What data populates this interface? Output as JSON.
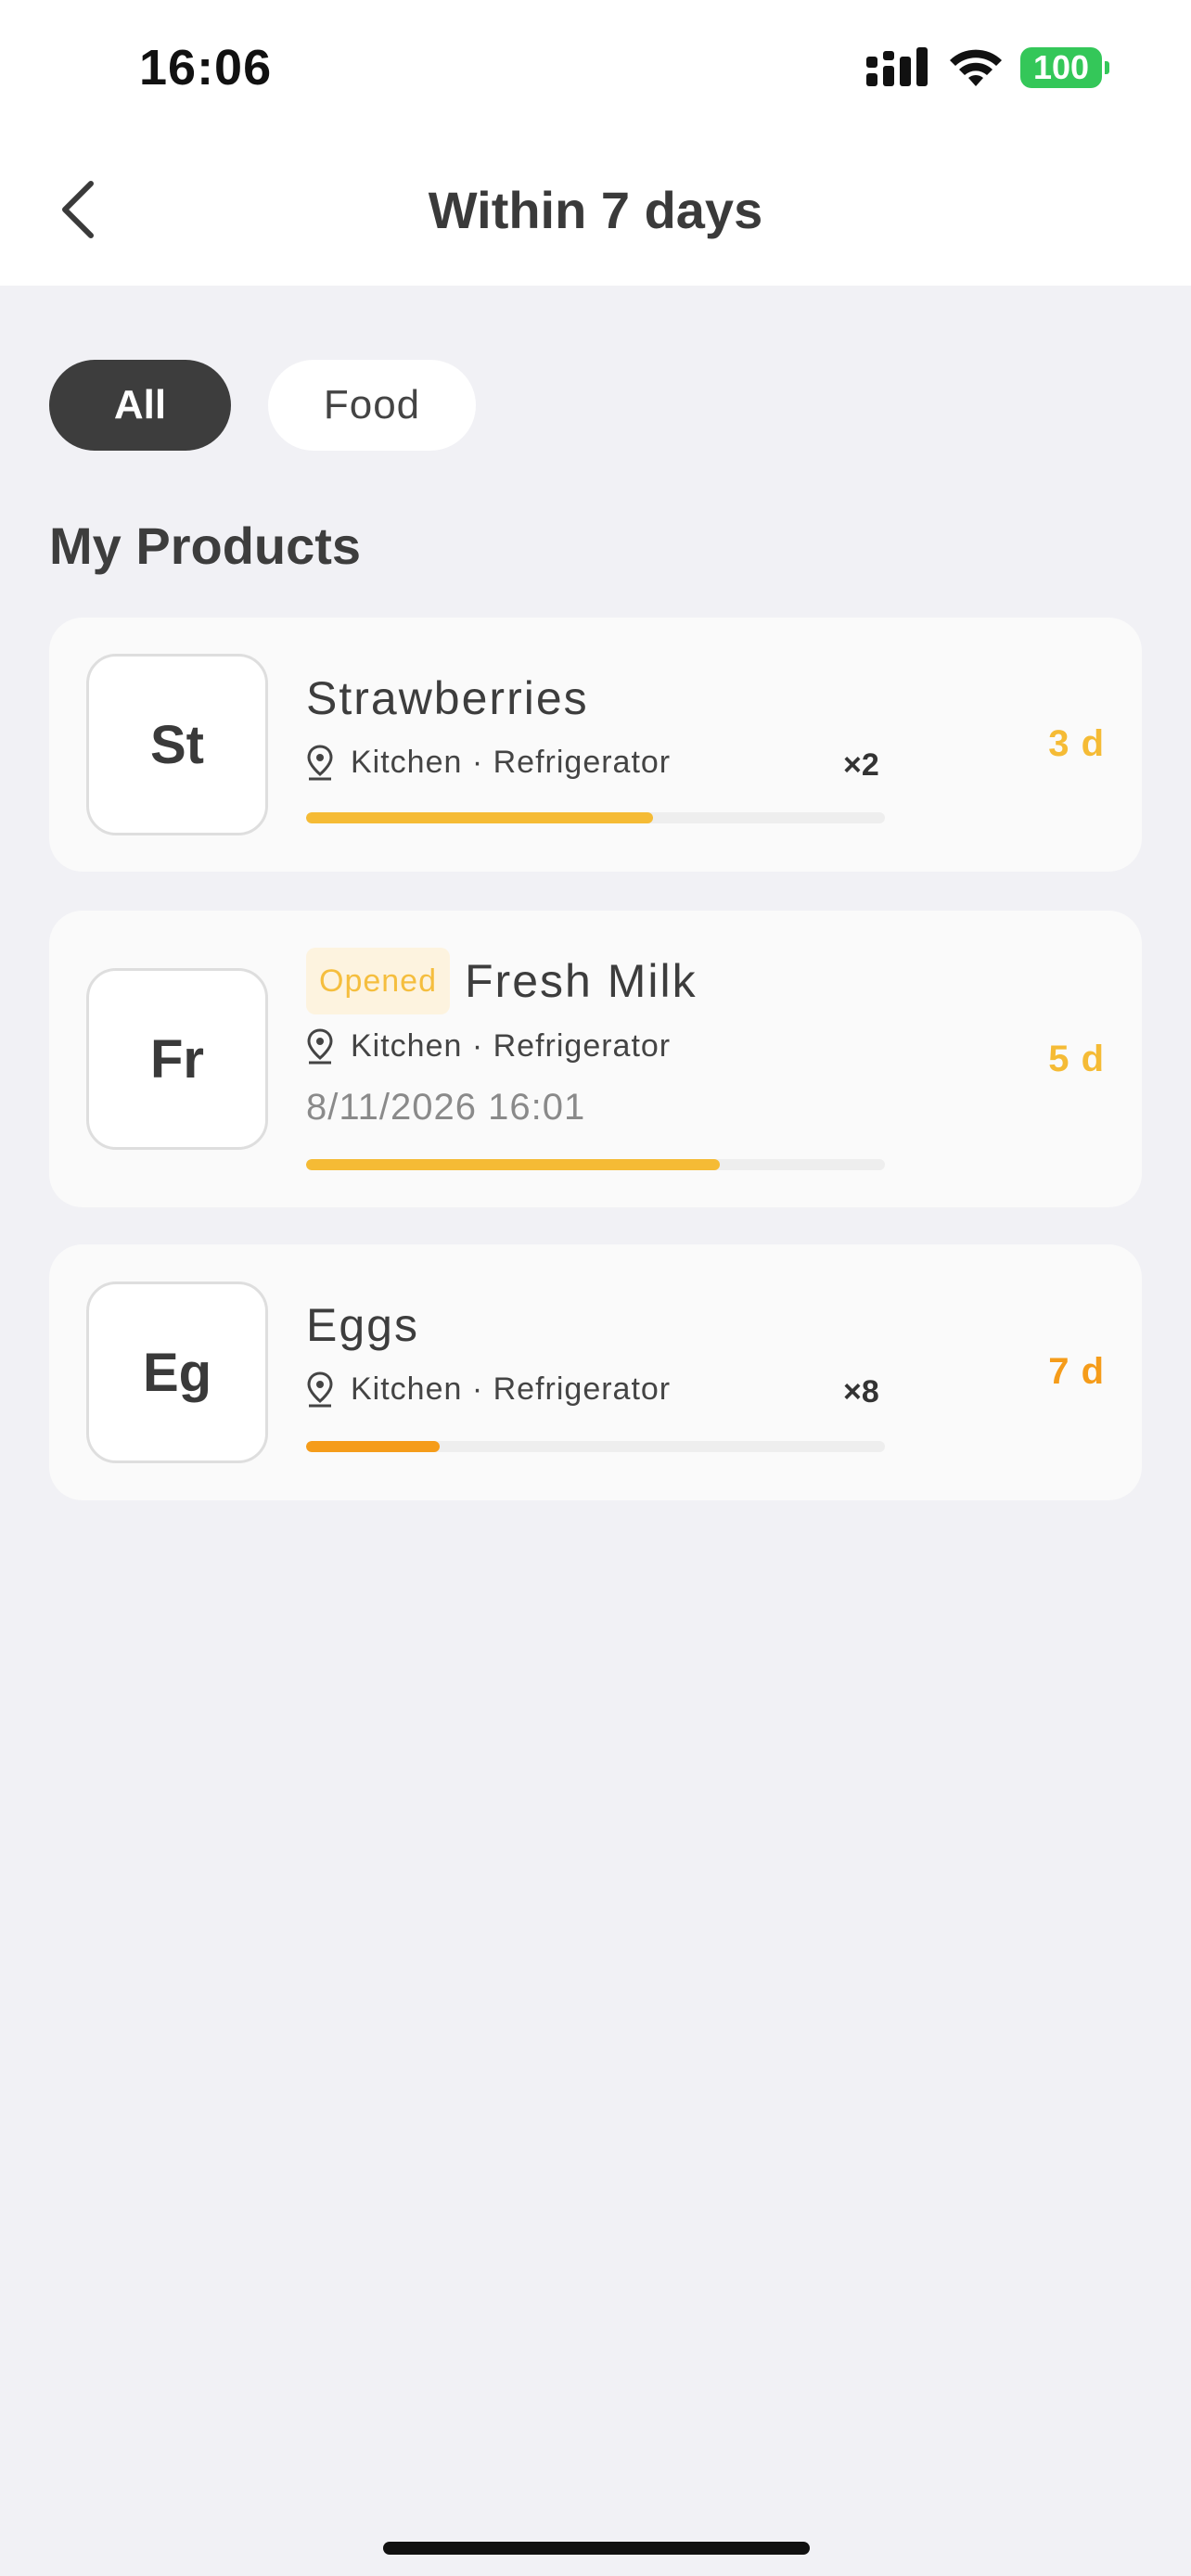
{
  "status_bar": {
    "time": "16:06",
    "battery": "100",
    "icons": [
      "signal-icon",
      "wifi-icon",
      "battery-icon"
    ]
  },
  "nav": {
    "title": "Within 7 days",
    "back_icon": "chevron-left-icon"
  },
  "filters": [
    {
      "label": "All",
      "selected": true
    },
    {
      "label": "Food",
      "selected": false
    }
  ],
  "section_title": "My Products",
  "products": [
    {
      "initials": "St",
      "name": "Strawberries",
      "badge": "",
      "location": "Kitchen · Refrigerator",
      "quantity": "×2",
      "date": "",
      "progress": 0.6,
      "days_left": "3 d",
      "color": "#f5bb35"
    },
    {
      "initials": "Fr",
      "name": "Fresh Milk",
      "badge": "Opened",
      "location": "Kitchen · Refrigerator",
      "quantity": "",
      "date": "8/11/2026 16:01",
      "progress": 0.714,
      "days_left": "5 d",
      "color": "#f5bb35"
    },
    {
      "initials": "Eg",
      "name": "Eggs",
      "badge": "",
      "location": "Kitchen · Refrigerator",
      "quantity": "×8",
      "date": "",
      "progress": 0.23,
      "days_left": "7 d",
      "color": "#f59c1a"
    }
  ]
}
